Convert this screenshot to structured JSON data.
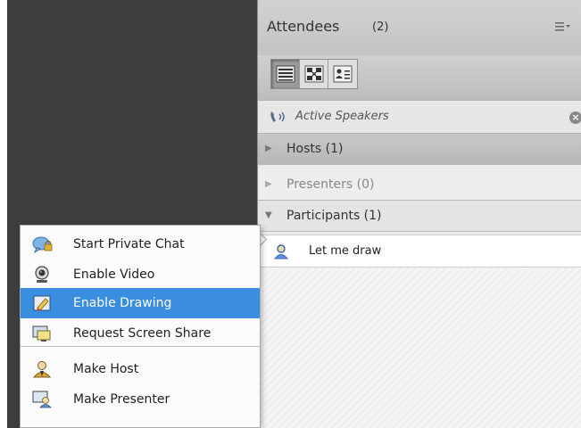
{
  "attendees_pod": {
    "title": "Attendees",
    "count": "(2)",
    "menu_icon": "hamburger-menu-icon",
    "view_buttons": [
      {
        "icon": "list-view-icon",
        "active": true
      },
      {
        "icon": "breakout-view-icon",
        "active": false
      },
      {
        "icon": "status-view-icon",
        "active": false
      }
    ],
    "active_speakers": {
      "label": "Active Speakers",
      "icon": "phone-speaker-icon",
      "close_icon": "close-circle-icon"
    },
    "groups": [
      {
        "label": "Hosts (1)",
        "expanded": false
      },
      {
        "label": "Presenters (0)",
        "expanded": false
      },
      {
        "label": "Participants (1)",
        "expanded": true
      }
    ],
    "attendees": [
      {
        "name": "Let me draw",
        "role": "participant",
        "icon": "participant-avatar-icon"
      }
    ]
  },
  "context_menu": {
    "items": [
      {
        "label": "Start Private Chat",
        "icon": "private-chat-icon",
        "selected": false
      },
      {
        "label": "Enable Video",
        "icon": "webcam-icon",
        "selected": false
      },
      {
        "label": "Enable Drawing",
        "icon": "drawing-pencil-icon",
        "selected": true
      },
      {
        "label": "Request Screen Share",
        "icon": "screen-share-icon",
        "selected": false
      },
      {
        "label": "Make Host",
        "icon": "host-avatar-icon",
        "selected": false
      },
      {
        "label": "Make Presenter",
        "icon": "presenter-icon",
        "selected": false
      }
    ]
  },
  "colors": {
    "selection": "#3b8de0",
    "dark_area": "#3d3d3d",
    "pod_header": "#c8c8c8"
  }
}
